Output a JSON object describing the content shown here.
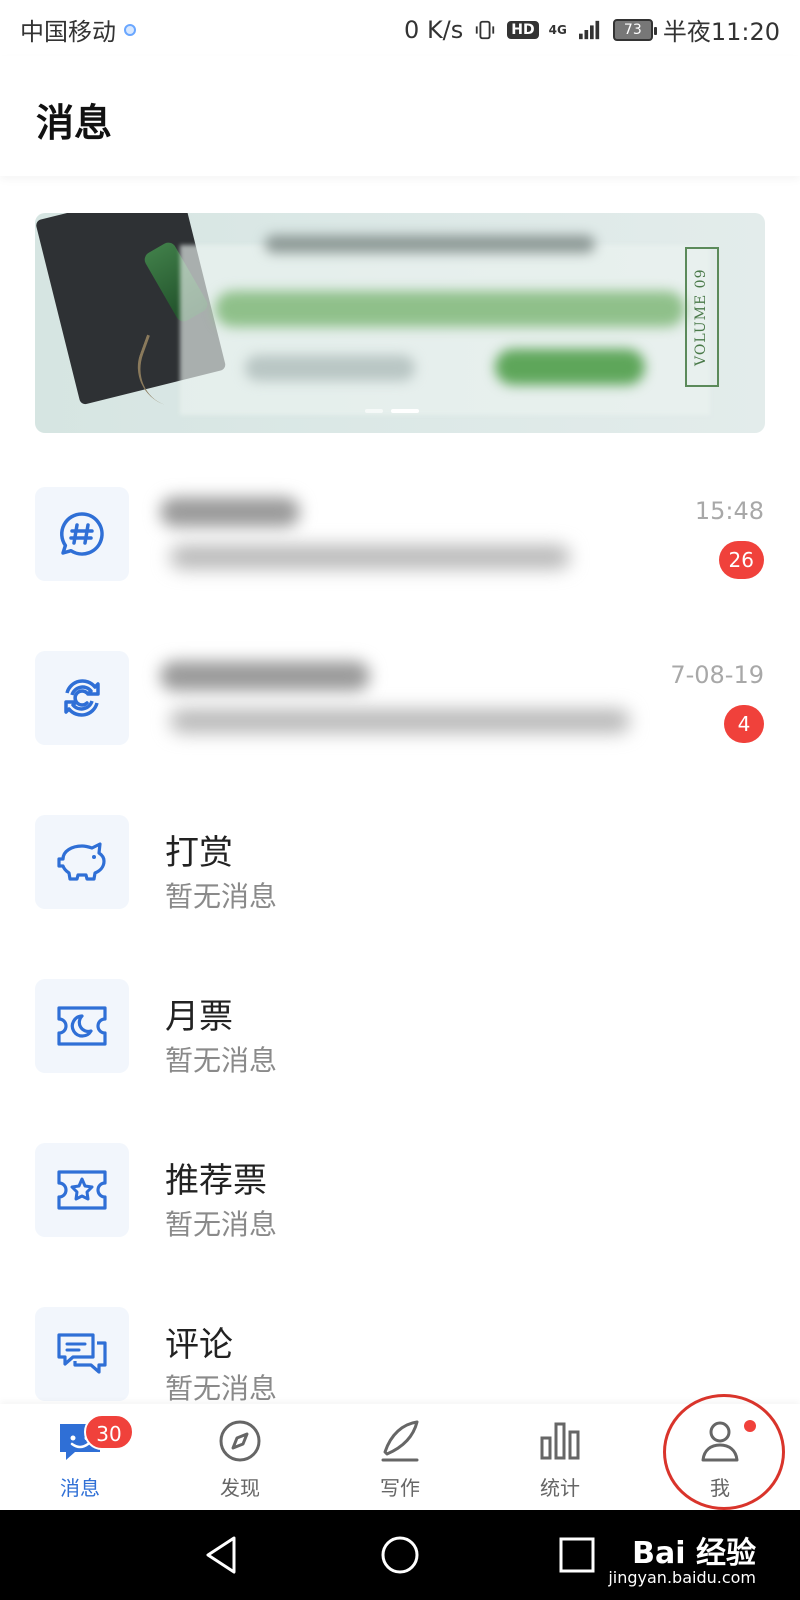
{
  "status_bar": {
    "carrier": "中国移动",
    "speed": "0 K/s",
    "hd": "HD",
    "network": "4G",
    "battery": "73",
    "time": "半夜11:20"
  },
  "header": {
    "title": "消息"
  },
  "banner": {
    "volume_text": "VOLUME 09",
    "page_count": 2,
    "active_page": 2
  },
  "messages": [
    {
      "icon": "hashtag-chat-icon",
      "title": "",
      "subtitle": "",
      "time": "15:48",
      "badge": "26"
    },
    {
      "icon": "refresh-c-icon",
      "title": "",
      "subtitle": "",
      "time": "7-08-19",
      "badge": "4"
    },
    {
      "icon": "piggy-bank-icon",
      "title": "打赏",
      "subtitle": "暂无消息"
    },
    {
      "icon": "moon-ticket-icon",
      "title": "月票",
      "subtitle": "暂无消息"
    },
    {
      "icon": "star-ticket-icon",
      "title": "推荐票",
      "subtitle": "暂无消息"
    },
    {
      "icon": "comment-bubbles-icon",
      "title": "评论",
      "subtitle": "暂无消息"
    }
  ],
  "tabbar": {
    "tabs": [
      {
        "label": "消息",
        "badge": "30",
        "active": true
      },
      {
        "label": "发现"
      },
      {
        "label": "写作"
      },
      {
        "label": "统计"
      },
      {
        "label": "我",
        "dot": true
      }
    ]
  },
  "watermark": {
    "brand": "Bai 经验",
    "url": "jingyan.baidu.com"
  },
  "colors": {
    "accent": "#2f6fd6",
    "badge": "#f0413b",
    "highlight": "#d9342b"
  }
}
